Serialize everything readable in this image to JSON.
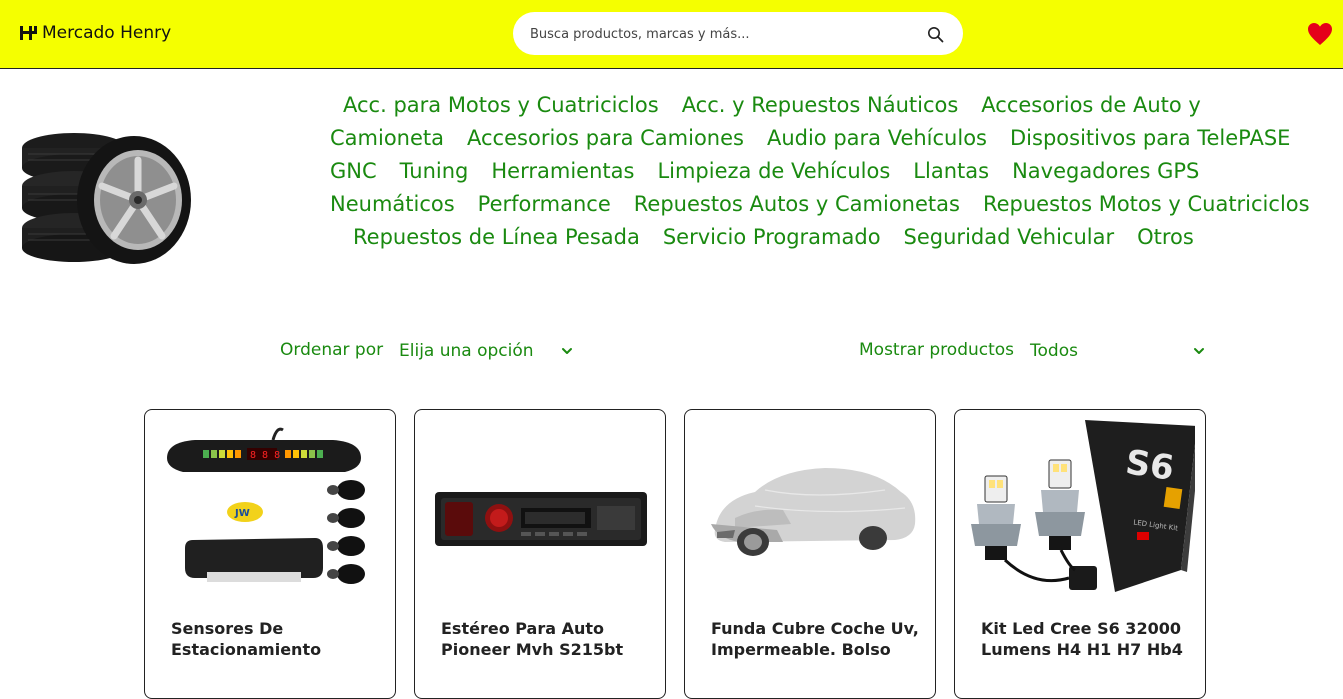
{
  "header": {
    "brand_name": "Mercado Henry",
    "search_placeholder": "Busca productos, marcas y más...",
    "accent": "#f5ff00"
  },
  "categories": [
    "Acc. para Motos y Cuatriciclos",
    "Acc. y Repuestos Náuticos",
    "Accesorios de Auto y Camioneta",
    "Accesorios para Camiones",
    "Audio para Vehículos",
    "Dispositivos para TelePASE",
    "GNC",
    "Tuning",
    "Herramientas",
    "Limpieza de Vehículos",
    "Llantas",
    "Navegadores GPS",
    "Neumáticos",
    "Performance",
    "Repuestos Autos y Camionetas",
    "Repuestos Motos y Cuatriciclos",
    "Repuestos de Línea Pesada",
    "Servicio Programado",
    "Seguridad Vehicular",
    "Otros"
  ],
  "filters": {
    "sort_label": "Ordenar por",
    "sort_value": "Elija una opción",
    "show_label": "Mostrar productos",
    "show_value": "Todos",
    "text_color": "#1a8a10"
  },
  "products": [
    {
      "title": "Sensores De Estacionamiento",
      "image": "parking-sensor-kit"
    },
    {
      "title": "Estéreo Para Auto Pioneer Mvh S215bt",
      "image": "car-stereo"
    },
    {
      "title": "Funda Cubre Coche Uv, Impermeable. Bolso",
      "image": "car-cover"
    },
    {
      "title": "Kit Led Cree S6 32000 Lumens H4 H1 H7 Hb4",
      "image": "led-headlight-kit"
    }
  ],
  "icons": {
    "logo": "henry-logo-icon",
    "search": "search-icon",
    "favorites": "heart-icon",
    "dropdown": "chevron-down-icon"
  }
}
